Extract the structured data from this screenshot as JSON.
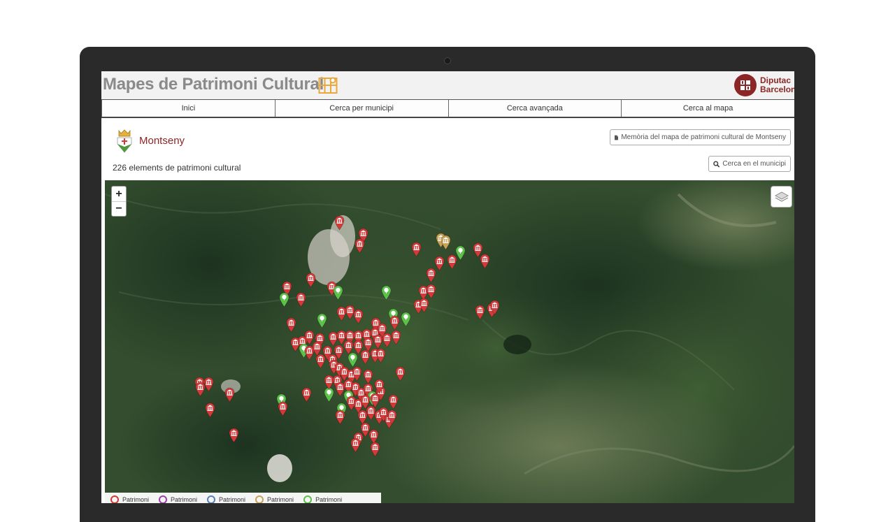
{
  "header": {
    "title": "Mapes de Patrimoni Cultural",
    "logo_icon": "map-icon",
    "institution_line1": "Diputac",
    "institution_line2": "Barcelon"
  },
  "nav": {
    "items": [
      {
        "label": "Inici"
      },
      {
        "label": "Cerca per municipi"
      },
      {
        "label": "Cerca avançada"
      },
      {
        "label": "Cerca al mapa"
      }
    ]
  },
  "municipality": {
    "name": "Montseny",
    "element_count_text": "226 elements de patrimoni cultural",
    "memoria_button": "Memòria del mapa de patrimoni cultural de Montseny",
    "search_button": "Cerca en el municipi"
  },
  "map": {
    "zoom_in": "+",
    "zoom_out": "−",
    "legend": [
      {
        "label": "Patrimoni",
        "color": "#d23a3a"
      },
      {
        "label": "Patrimoni",
        "color": "#a13fb0"
      },
      {
        "label": "Patrimoni",
        "color": "#5d7fb8"
      },
      {
        "label": "Patrimoni",
        "color": "#c9a257"
      },
      {
        "label": "Patrimoni",
        "color": "#5cc04a"
      }
    ]
  },
  "colors": {
    "accent": "#8c2626",
    "pin_red": "#d23a3a",
    "pin_green": "#5cc04a",
    "pin_gold": "#c9a257"
  }
}
